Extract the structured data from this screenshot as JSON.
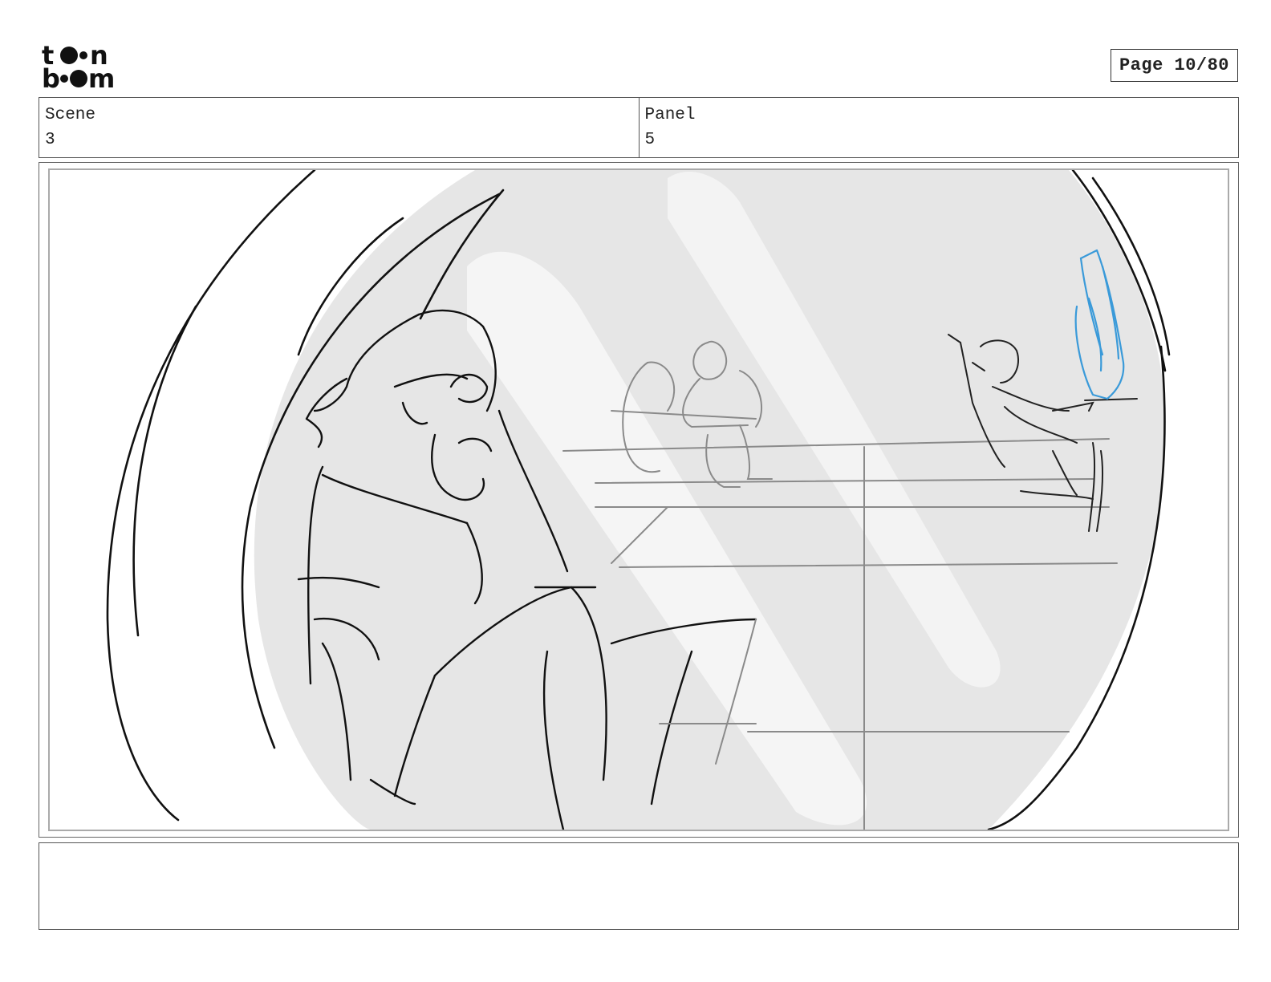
{
  "header": {
    "logo_text": "toon boom",
    "page_label": "Page 10/80"
  },
  "info": {
    "scene_label": "Scene",
    "scene_value": "3",
    "panel_label": "Panel",
    "panel_value": "5"
  },
  "notes": {
    "text": ""
  },
  "colors": {
    "sketch_line": "#111111",
    "background_sketch": "#8a8a8a",
    "accent_blue": "#3a9ad9",
    "fill_gray": "#e4e4e4"
  }
}
